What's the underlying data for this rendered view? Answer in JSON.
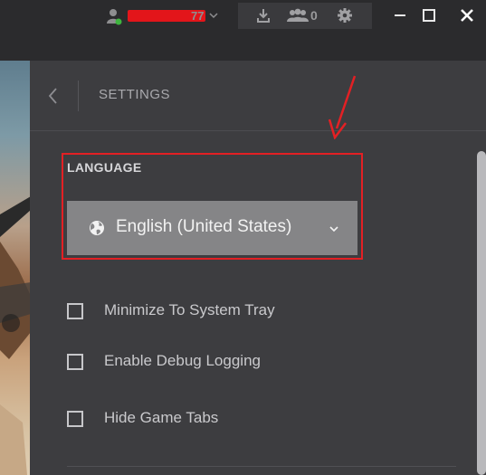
{
  "titlebar": {
    "username_suffix": "77",
    "friends_count": "0"
  },
  "settings": {
    "title": "SETTINGS",
    "language_section": {
      "label": "LANGUAGE",
      "selected": "English (United States)"
    },
    "options": [
      {
        "label": "Minimize To System Tray",
        "checked": false
      },
      {
        "label": "Enable Debug Logging",
        "checked": false
      },
      {
        "label": "Hide Game Tabs",
        "checked": false
      }
    ]
  },
  "colors": {
    "panel_bg": "#3d3d40",
    "titlebar_bg": "#2b2b2d",
    "dropdown_bg": "#858587",
    "highlight": "#e32024",
    "online_status": "#3fb53f"
  },
  "icons": [
    "user-icon",
    "download-icon",
    "friends-icon",
    "gear-icon",
    "minimize-icon",
    "maximize-icon",
    "close-icon",
    "back-icon",
    "globe-icon",
    "chevron-down-icon"
  ]
}
